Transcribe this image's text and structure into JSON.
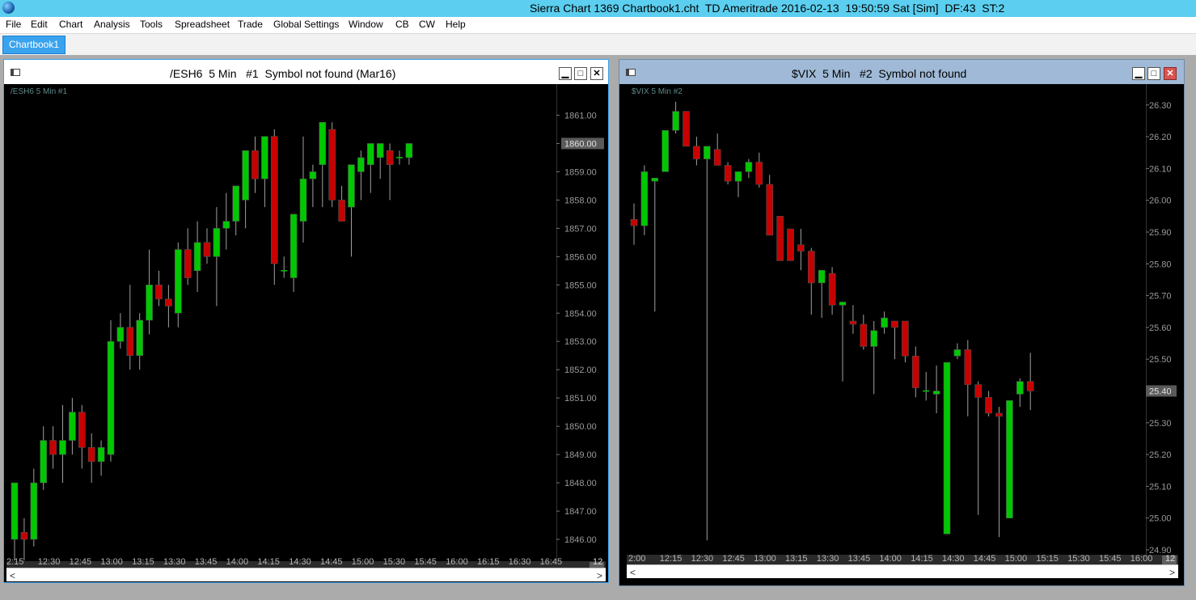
{
  "app": {
    "title": "Sierra Chart 1369 Chartbook1.cht  TD Ameritrade 2016-02-13  19:50:59 Sat [Sim]  DF:43  ST:2"
  },
  "menu": [
    "File",
    "Edit",
    "Chart",
    "Analysis",
    "Tools",
    "Spreadsheet",
    "Trade",
    "Global Settings",
    "Window",
    "CB",
    "CW",
    "Help"
  ],
  "tabs": [
    {
      "label": "Chartbook1",
      "active": true
    }
  ],
  "window_buttons": {
    "minimize": "▁",
    "maximize": "□",
    "close": "✕"
  },
  "scroll_arrows": {
    "left": "<",
    "right": ">"
  },
  "charts": [
    {
      "window_title": "/ESH6  5 Min   #1  Symbol not found (Mar16)",
      "chart_label": "/ESH6   5 Min   #1",
      "corner_label": "12",
      "price_axis": {
        "min": 1845.4,
        "max": 1861.7,
        "ticks": [
          "1861.00",
          "1860.00",
          "1859.00",
          "1858.00",
          "1857.00",
          "1856.00",
          "1855.00",
          "1854.00",
          "1853.00",
          "1852.00",
          "1851.00",
          "1850.00",
          "1849.00",
          "1848.00",
          "1847.00",
          "1846.00"
        ],
        "current_price": "1860.00"
      },
      "time_axis": [
        "2:15",
        "12:30",
        "12:45",
        "13:00",
        "13:15",
        "13:30",
        "13:45",
        "14:00",
        "14:15",
        "14:30",
        "14:45",
        "15:00",
        "15:30",
        "15:45",
        "16:00",
        "16:15",
        "16:30",
        "16:45"
      ],
      "colors": {
        "up": "#00c800",
        "down": "#c80000",
        "wick": "#a0a0a0",
        "axis_text": "#9a9a9a",
        "label": "#5f8a8a"
      },
      "chart_data": {
        "type": "candlestick",
        "series": [
          {
            "name": "/ESH6",
            "ohlc": [
              [
                1846.0,
                1848.0,
                1845.25,
                1848.0
              ],
              [
                1846.25,
                1846.75,
                1845.25,
                1846.0
              ],
              [
                1846.0,
                1848.5,
                1845.75,
                1848.0
              ],
              [
                1848.0,
                1850.0,
                1847.75,
                1849.5
              ],
              [
                1849.5,
                1850.0,
                1848.5,
                1849.0
              ],
              [
                1849.0,
                1850.75,
                1848.0,
                1849.5
              ],
              [
                1849.5,
                1851.0,
                1849.0,
                1850.5
              ],
              [
                1850.5,
                1850.75,
                1848.5,
                1849.25
              ],
              [
                1849.25,
                1849.75,
                1848.0,
                1848.75
              ],
              [
                1848.75,
                1849.5,
                1848.25,
                1849.25
              ],
              [
                1849.0,
                1853.75,
                1848.75,
                1853.0
              ],
              [
                1853.0,
                1854.0,
                1852.75,
                1853.5
              ],
              [
                1853.5,
                1855.0,
                1852.0,
                1852.5
              ],
              [
                1852.5,
                1854.0,
                1852.0,
                1853.75
              ],
              [
                1853.75,
                1856.25,
                1853.25,
                1855.0
              ],
              [
                1855.0,
                1855.5,
                1854.25,
                1854.5
              ],
              [
                1854.5,
                1855.0,
                1853.5,
                1854.25
              ],
              [
                1854.0,
                1856.5,
                1853.5,
                1856.25
              ],
              [
                1856.25,
                1857.0,
                1855.0,
                1855.25
              ],
              [
                1855.5,
                1857.25,
                1854.75,
                1856.5
              ],
              [
                1856.5,
                1857.0,
                1855.75,
                1856.0
              ],
              [
                1856.0,
                1857.75,
                1854.25,
                1857.0
              ],
              [
                1857.0,
                1858.25,
                1856.25,
                1857.25
              ],
              [
                1857.25,
                1858.5,
                1856.75,
                1858.5
              ],
              [
                1858.0,
                1859.75,
                1857.0,
                1859.75
              ],
              [
                1859.75,
                1860.25,
                1858.25,
                1858.75
              ],
              [
                1858.75,
                1860.25,
                1857.75,
                1860.25
              ],
              [
                1860.25,
                1860.5,
                1855.0,
                1855.75
              ],
              [
                1855.5,
                1856.0,
                1855.25,
                1855.5
              ],
              [
                1855.25,
                1857.5,
                1854.75,
                1857.5
              ],
              [
                1857.25,
                1860.25,
                1856.5,
                1858.75
              ],
              [
                1858.75,
                1859.25,
                1857.75,
                1859.0
              ],
              [
                1859.25,
                1860.75,
                1857.75,
                1860.75
              ],
              [
                1860.5,
                1860.75,
                1857.75,
                1858.0
              ],
              [
                1858.0,
                1858.5,
                1857.25,
                1857.25
              ],
              [
                1857.75,
                1859.25,
                1856.0,
                1859.25
              ],
              [
                1859.0,
                1859.75,
                1858.0,
                1859.5
              ],
              [
                1859.25,
                1860.0,
                1858.25,
                1860.0
              ],
              [
                1859.5,
                1860.0,
                1858.75,
                1860.0
              ],
              [
                1859.75,
                1860.0,
                1858.0,
                1859.25
              ],
              [
                1859.5,
                1859.75,
                1859.25,
                1859.5
              ],
              [
                1859.5,
                1860.0,
                1859.25,
                1860.0
              ]
            ]
          }
        ]
      }
    },
    {
      "window_title": "$VIX  5 Min   #2  Symbol not found",
      "chart_label": "$VIX   5 Min   #2",
      "corner_label": "12",
      "price_axis": {
        "min": 24.9,
        "max": 26.33,
        "ticks": [
          "26.30",
          "26.20",
          "26.10",
          "26.00",
          "25.90",
          "25.80",
          "25.70",
          "25.60",
          "25.50",
          "25.40",
          "25.30",
          "25.20",
          "25.10",
          "25.00",
          "24.90"
        ],
        "current_price": "25.40"
      },
      "time_axis": [
        "2:00",
        "12:15",
        "12:30",
        "12:45",
        "13:00",
        "13:15",
        "13:30",
        "13:45",
        "14:00",
        "14:15",
        "14:30",
        "14:45",
        "15:00",
        "15:15",
        "15:30",
        "15:45",
        "16:00"
      ],
      "colors": {
        "up": "#00c800",
        "down": "#c80000",
        "wick": "#a0a0a0",
        "axis_text": "#9a9a9a",
        "label": "#5f8a8a"
      },
      "chart_data": {
        "type": "candlestick",
        "series": [
          {
            "name": "$VIX",
            "ohlc": [
              [
                25.94,
                25.99,
                25.86,
                25.92
              ],
              [
                25.92,
                26.11,
                25.89,
                26.09
              ],
              [
                26.06,
                26.07,
                25.65,
                26.07
              ],
              [
                26.09,
                26.22,
                26.09,
                26.22
              ],
              [
                26.22,
                26.31,
                26.21,
                26.28
              ],
              [
                26.28,
                26.28,
                26.17,
                26.17
              ],
              [
                26.17,
                26.2,
                26.11,
                26.13
              ],
              [
                26.13,
                26.17,
                24.93,
                26.17
              ],
              [
                26.16,
                26.21,
                26.11,
                26.11
              ],
              [
                26.11,
                26.12,
                26.05,
                26.06
              ],
              [
                26.06,
                26.08,
                26.01,
                26.09
              ],
              [
                26.09,
                26.13,
                26.07,
                26.12
              ],
              [
                26.12,
                26.15,
                26.04,
                26.05
              ],
              [
                26.05,
                26.08,
                25.89,
                25.89
              ],
              [
                25.95,
                25.95,
                25.81,
                25.81
              ],
              [
                25.91,
                25.91,
                25.81,
                25.81
              ],
              [
                25.86,
                25.91,
                25.78,
                25.84
              ],
              [
                25.84,
                25.85,
                25.64,
                25.74
              ],
              [
                25.74,
                25.78,
                25.63,
                25.78
              ],
              [
                25.77,
                25.79,
                25.64,
                25.67
              ],
              [
                25.67,
                25.68,
                25.43,
                25.68
              ],
              [
                25.62,
                25.67,
                25.58,
                25.61
              ],
              [
                25.61,
                25.64,
                25.53,
                25.54
              ],
              [
                25.54,
                25.62,
                25.39,
                25.59
              ],
              [
                25.6,
                25.65,
                25.58,
                25.63
              ],
              [
                25.62,
                25.62,
                25.5,
                25.6
              ],
              [
                25.62,
                25.62,
                25.49,
                25.51
              ],
              [
                25.51,
                25.54,
                25.38,
                25.41
              ],
              [
                25.4,
                25.46,
                25.37,
                25.4
              ],
              [
                25.39,
                25.48,
                25.33,
                25.4
              ],
              [
                24.95,
                25.49,
                24.95,
                25.49
              ],
              [
                25.51,
                25.55,
                25.5,
                25.53
              ],
              [
                25.53,
                25.56,
                25.32,
                25.42
              ],
              [
                25.42,
                25.43,
                25.01,
                25.38
              ],
              [
                25.38,
                25.4,
                25.32,
                25.33
              ],
              [
                25.33,
                25.35,
                24.94,
                25.32
              ],
              [
                25.0,
                25.37,
                25.0,
                25.37
              ],
              [
                25.39,
                25.44,
                25.35,
                25.43
              ],
              [
                25.43,
                25.52,
                25.34,
                25.4
              ]
            ]
          }
        ]
      }
    }
  ]
}
